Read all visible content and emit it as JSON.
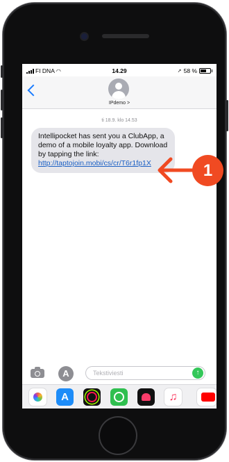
{
  "status_bar": {
    "carrier": "FI DNA",
    "time": "14.29",
    "battery_percent": "58 %",
    "battery_level": 0.58
  },
  "conversation": {
    "contact_name": "IPdemo >",
    "timestamp": "ti 18.9. klo 14.53",
    "message_text": "Intellipocket has sent you a ClubApp, a demo of a mobile loyalty app. Download by tapping the link: ",
    "message_link": "http://taptojoin.mobi/cs/cr/T6r1fp1X"
  },
  "compose": {
    "placeholder": "Tekstiviesti"
  },
  "annotation": {
    "marker_label": "1",
    "color": "#f04a22"
  },
  "colors": {
    "accent": "#1a7cff",
    "bubble": "#e5e5ea",
    "send": "#34c759"
  },
  "icons": [
    "back-chevron-icon",
    "avatar-icon",
    "camera-icon",
    "appstore-icon",
    "send-arrow-icon",
    "photos-icon",
    "activity-icon",
    "music-icon",
    "youtube-icon"
  ]
}
